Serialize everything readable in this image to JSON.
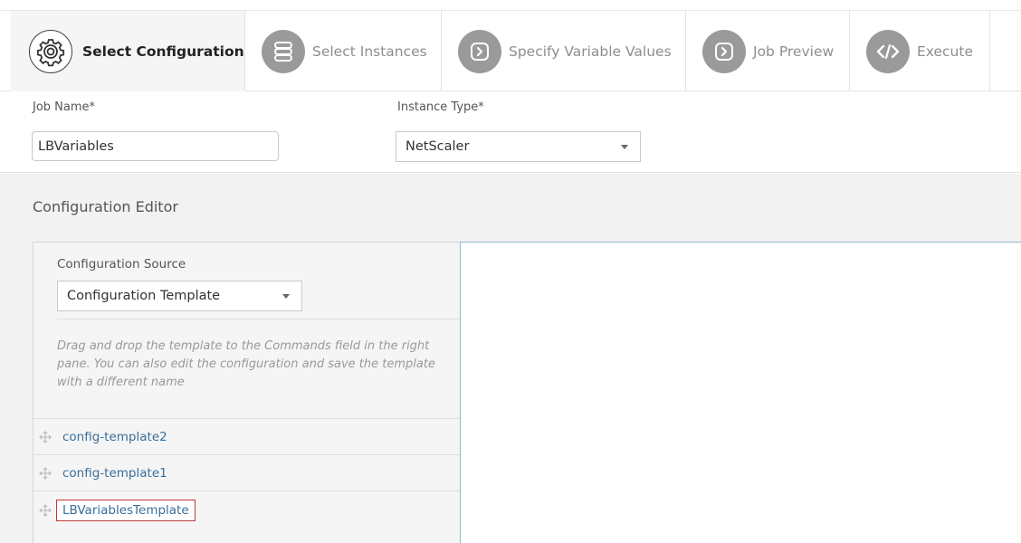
{
  "wizard": {
    "steps": [
      {
        "label": "Select Configuration",
        "icon": "gear-icon",
        "active": true
      },
      {
        "label": "Select Instances",
        "icon": "server-stack-icon",
        "active": false
      },
      {
        "label": "Specify Variable Values",
        "icon": "chevron-right-box-icon",
        "active": false
      },
      {
        "label": "Job Preview",
        "icon": "chevron-right-box-icon",
        "active": false
      },
      {
        "label": "Execute",
        "icon": "code-icon",
        "active": false
      }
    ]
  },
  "job": {
    "name_label": "Job Name*",
    "name_value": "LBVariables",
    "instance_type_label": "Instance Type*",
    "instance_type_value": "NetScaler"
  },
  "editor": {
    "title": "Configuration Editor",
    "source_label": "Configuration Source",
    "source_value": "Configuration Template",
    "help_text": "Drag and drop the template to the Commands field in the right pane. You can also edit the configuration and save the template with a different name",
    "templates": [
      {
        "name": "config-template2",
        "icon": "drag-handle-icon"
      },
      {
        "name": "config-template1",
        "icon": "drag-handle-icon"
      },
      {
        "name": "LBVariablesTemplate",
        "icon": "drag-handle-icon",
        "highlighted": true
      }
    ]
  },
  "colors": {
    "link": "#3a6e9a",
    "highlight_border": "#c0393b",
    "step_icon_bg": "#9a9a9a",
    "active_step_bg": "#f5f5f5"
  }
}
